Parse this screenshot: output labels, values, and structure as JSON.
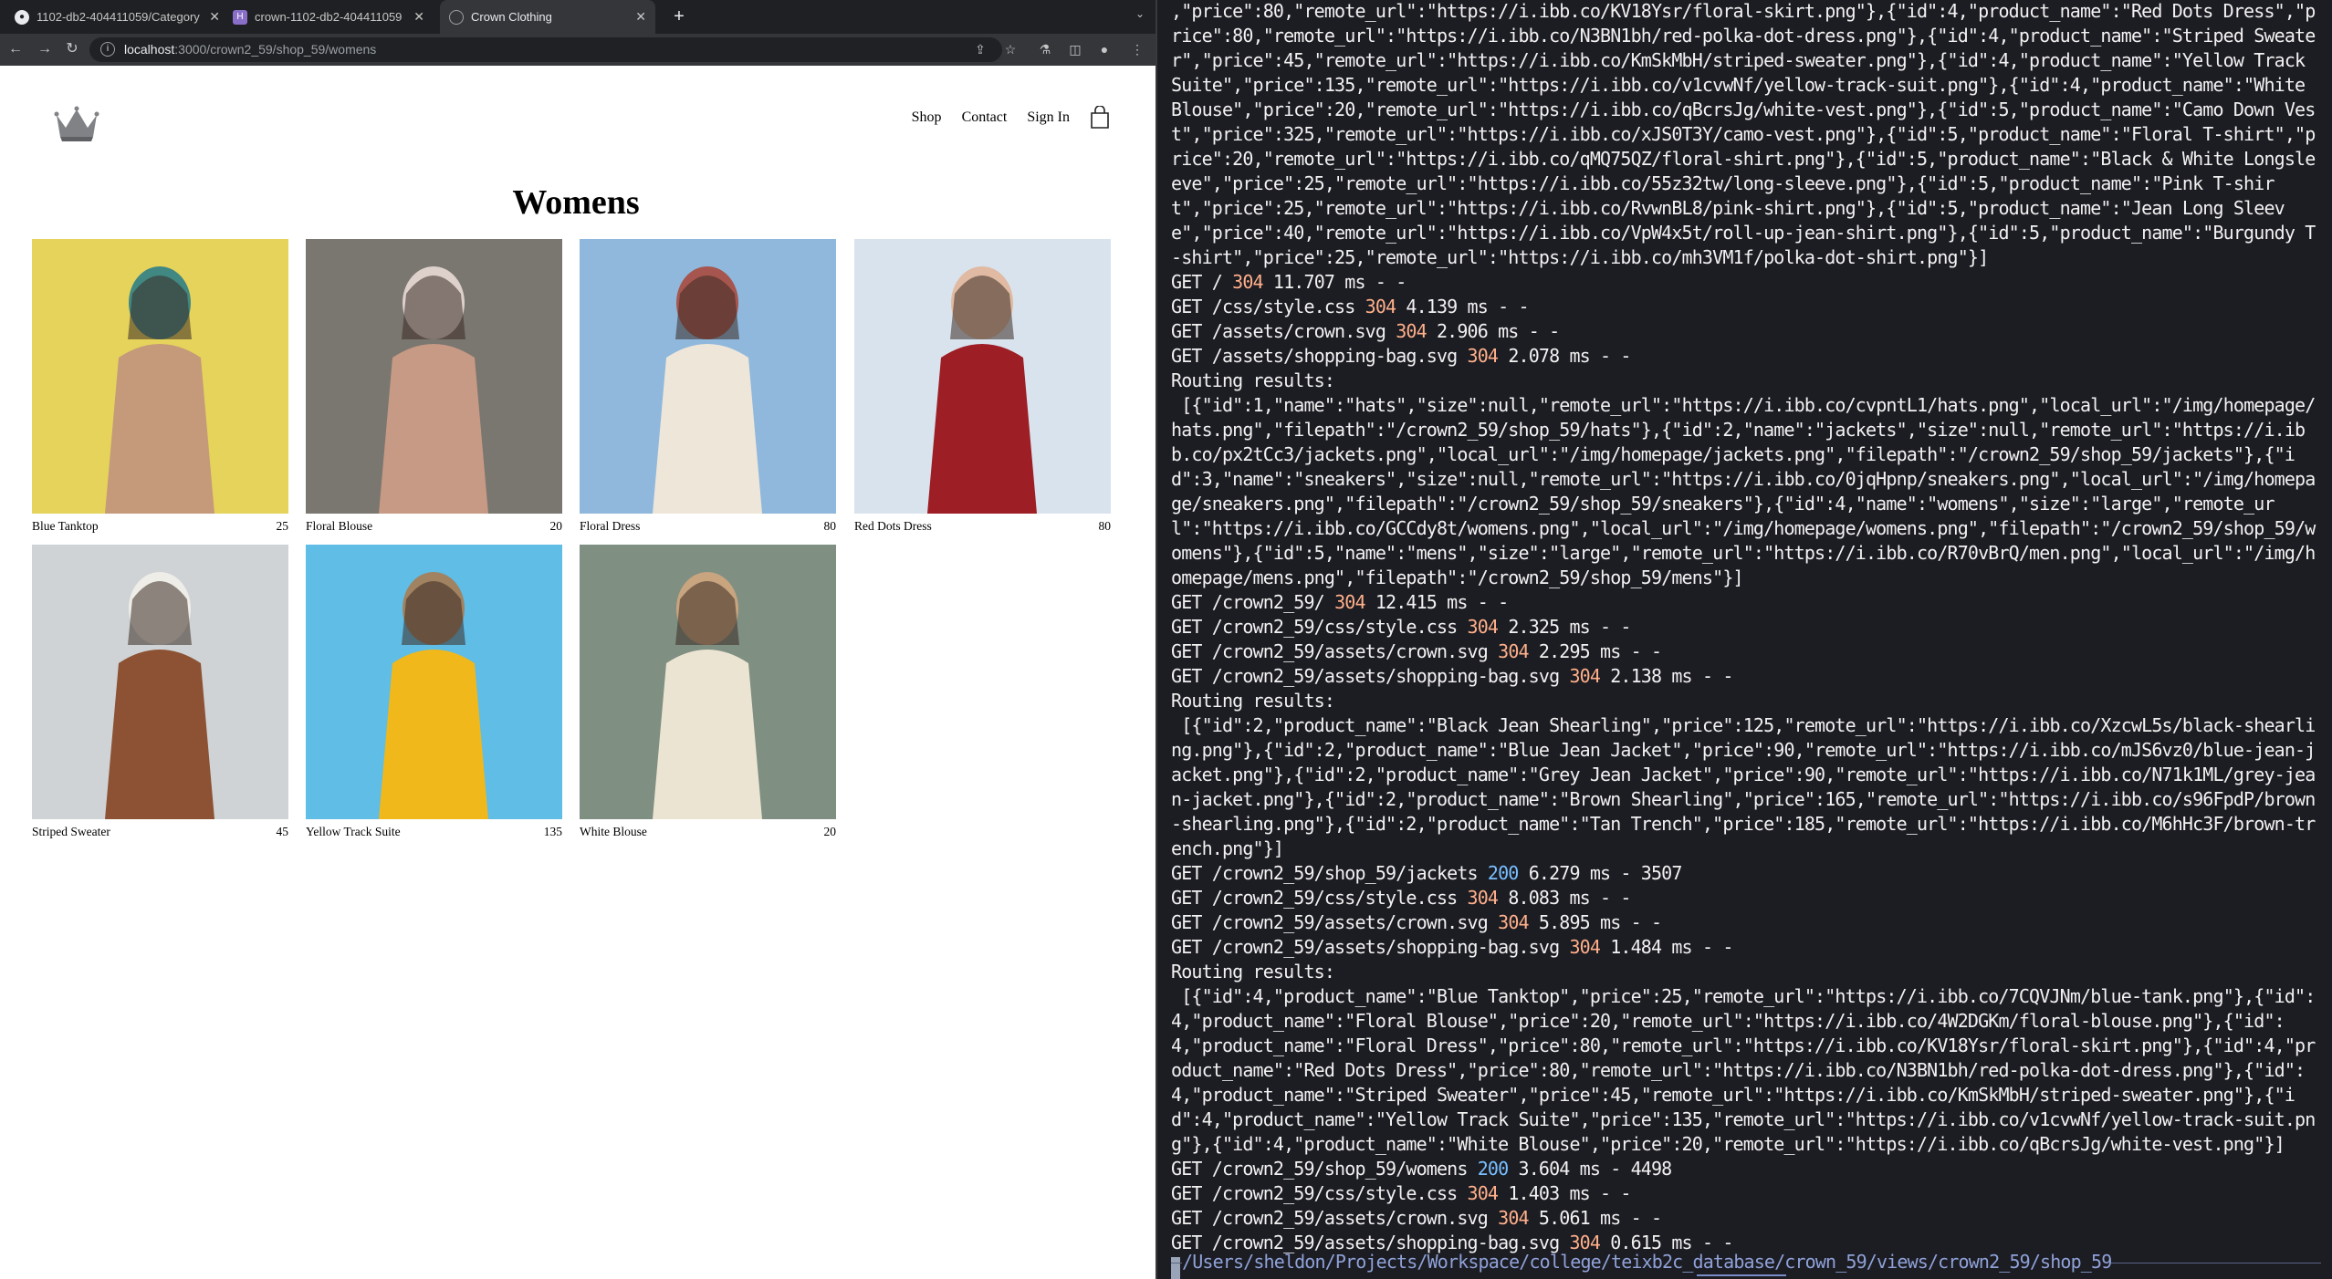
{
  "browser": {
    "tabs": [
      {
        "title": "1102-db2-404411059/Category",
        "favicon": "github-icon"
      },
      {
        "title": "crown-1102-db2-404411059",
        "favicon": "heroku-icon"
      },
      {
        "title": "Crown Clothing",
        "favicon": "globe-icon",
        "active": true
      }
    ],
    "url_host": "localhost",
    "url_path": ":3000/crown2_59/shop_59/womens"
  },
  "site": {
    "nav": {
      "shop": "Shop",
      "contact": "Contact",
      "sign_in": "Sign In"
    },
    "page_title": "Womens",
    "products": [
      {
        "name": "Blue Tanktop",
        "price": "25",
        "palette": [
          "#e6d35c",
          "#c49a7a",
          "#2f7f86"
        ]
      },
      {
        "name": "Floral Blouse",
        "price": "20",
        "palette": [
          "#7a7670",
          "#c69a84",
          "#e9dcd6"
        ]
      },
      {
        "name": "Floral Dress",
        "price": "80",
        "palette": [
          "#8fb8dc",
          "#efe6da",
          "#a94b3e"
        ]
      },
      {
        "name": "Red Dots Dress",
        "price": "80",
        "palette": [
          "#d9e3ee",
          "#9d1e24",
          "#e0b599"
        ]
      },
      {
        "name": "Striped Sweater",
        "price": "45",
        "palette": [
          "#cfd3d6",
          "#8c5233",
          "#f2efea"
        ]
      },
      {
        "name": "Yellow Track Suite",
        "price": "135",
        "palette": [
          "#5fbde6",
          "#f0b81a",
          "#a87b52"
        ]
      },
      {
        "name": "White Blouse",
        "price": "20",
        "palette": [
          "#7f8f82",
          "#ece4d2",
          "#d0a67e"
        ]
      }
    ]
  },
  "terminal": {
    "lines": [
      {
        "text": ",\"price\":80,\"remote_url\":\"https://i.ibb.co/KV18Ysr/floral-skirt.png\"},{\"id\":4,\"product_name\":\"Red Dots Dress\",\"price\":80,\"remote_url\":\"https://i.ibb.co/N3BN1bh/red-polka-dot-dress.png\"},{\"id\":4,\"product_name\":\"Striped Sweater\",\"price\":45,\"remote_url\":\"https://i.ibb.co/KmSkMbH/striped-sweater.png\"},{\"id\":4,\"product_name\":\"Yellow Track Suite\",\"price\":135,\"remote_url\":\"https://i.ibb.co/v1cvwNf/yellow-track-suit.png\"},{\"id\":4,\"product_name\":\"White Blouse\",\"price\":20,\"remote_url\":\"https://i.ibb.co/qBcrsJg/white-vest.png\"},{\"id\":5,\"product_name\":\"Camo Down Vest\",\"price\":325,\"remote_url\":\"https://i.ibb.co/xJS0T3Y/camo-vest.png\"},{\"id\":5,\"product_name\":\"Floral T-shirt\",\"price\":20,\"remote_url\":\"https://i.ibb.co/qMQ75QZ/floral-shirt.png\"},{\"id\":5,\"product_name\":\"Black & White Longsleeve\",\"price\":25,\"remote_url\":\"https://i.ibb.co/55z32tw/long-sleeve.png\"},{\"id\":5,\"product_name\":\"Pink T-shirt\",\"price\":25,\"remote_url\":\"https://i.ibb.co/RvwnBL8/pink-shirt.png\"},{\"id\":5,\"product_name\":\"Jean Long Sleeve\",\"price\":40,\"remote_url\":\"https://i.ibb.co/VpW4x5t/roll-up-jean-shirt.png\"},{\"id\":5,\"product_name\":\"Burgundy T-shirt\",\"price\":25,\"remote_url\":\"https://i.ibb.co/mh3VM1f/polka-dot-shirt.png\"}]"
      },
      {
        "pre": "GET / ",
        "code": "304",
        "post": " 11.707 ms - -"
      },
      {
        "pre": "GET /css/style.css ",
        "code": "304",
        "post": " 4.139 ms - -"
      },
      {
        "pre": "GET /assets/crown.svg ",
        "code": "304",
        "post": " 2.906 ms - -"
      },
      {
        "pre": "GET /assets/shopping-bag.svg ",
        "code": "304",
        "post": " 2.078 ms - -"
      },
      {
        "text": "Routing results:"
      },
      {
        "text": " [{\"id\":1,\"name\":\"hats\",\"size\":null,\"remote_url\":\"https://i.ibb.co/cvpntL1/hats.png\",\"local_url\":\"/img/homepage/hats.png\",\"filepath\":\"/crown2_59/shop_59/hats\"},{\"id\":2,\"name\":\"jackets\",\"size\":null,\"remote_url\":\"https://i.ibb.co/px2tCc3/jackets.png\",\"local_url\":\"/img/homepage/jackets.png\",\"filepath\":\"/crown2_59/shop_59/jackets\"},{\"id\":3,\"name\":\"sneakers\",\"size\":null,\"remote_url\":\"https://i.ibb.co/0jqHpnp/sneakers.png\",\"local_url\":\"/img/homepage/sneakers.png\",\"filepath\":\"/crown2_59/shop_59/sneakers\"},{\"id\":4,\"name\":\"womens\",\"size\":\"large\",\"remote_url\":\"https://i.ibb.co/GCCdy8t/womens.png\",\"local_url\":\"/img/homepage/womens.png\",\"filepath\":\"/crown2_59/shop_59/womens\"},{\"id\":5,\"name\":\"mens\",\"size\":\"large\",\"remote_url\":\"https://i.ibb.co/R70vBrQ/men.png\",\"local_url\":\"/img/homepage/mens.png\",\"filepath\":\"/crown2_59/shop_59/mens\"}]"
      },
      {
        "pre": "GET /crown2_59/ ",
        "code": "304",
        "post": " 12.415 ms - -"
      },
      {
        "pre": "GET /crown2_59/css/style.css ",
        "code": "304",
        "post": " 2.325 ms - -"
      },
      {
        "pre": "GET /crown2_59/assets/crown.svg ",
        "code": "304",
        "post": " 2.295 ms - -"
      },
      {
        "pre": "GET /crown2_59/assets/shopping-bag.svg ",
        "code": "304",
        "post": " 2.138 ms - -"
      },
      {
        "text": "Routing results:"
      },
      {
        "text": " [{\"id\":2,\"product_name\":\"Black Jean Shearling\",\"price\":125,\"remote_url\":\"https://i.ibb.co/XzcwL5s/black-shearling.png\"},{\"id\":2,\"product_name\":\"Blue Jean Jacket\",\"price\":90,\"remote_url\":\"https://i.ibb.co/mJS6vz0/blue-jean-jacket.png\"},{\"id\":2,\"product_name\":\"Grey Jean Jacket\",\"price\":90,\"remote_url\":\"https://i.ibb.co/N71k1ML/grey-jean-jacket.png\"},{\"id\":2,\"product_name\":\"Brown Shearling\",\"price\":165,\"remote_url\":\"https://i.ibb.co/s96FpdP/brown-shearling.png\"},{\"id\":2,\"product_name\":\"Tan Trench\",\"price\":185,\"remote_url\":\"https://i.ibb.co/M6hHc3F/brown-trench.png\"}]"
      },
      {
        "pre": "GET /crown2_59/shop_59/jackets ",
        "code": "200",
        "post": " 6.279 ms - 3507"
      },
      {
        "pre": "GET /crown2_59/css/style.css ",
        "code": "304",
        "post": " 8.083 ms - -"
      },
      {
        "pre": "GET /crown2_59/assets/crown.svg ",
        "code": "304",
        "post": " 5.895 ms - -"
      },
      {
        "pre": "GET /crown2_59/assets/shopping-bag.svg ",
        "code": "304",
        "post": " 1.484 ms - -"
      },
      {
        "text": "Routing results:"
      },
      {
        "text": " [{\"id\":4,\"product_name\":\"Blue Tanktop\",\"price\":25,\"remote_url\":\"https://i.ibb.co/7CQVJNm/blue-tank.png\"},{\"id\":4,\"product_name\":\"Floral Blouse\",\"price\":20,\"remote_url\":\"https://i.ibb.co/4W2DGKm/floral-blouse.png\"},{\"id\":4,\"product_name\":\"Floral Dress\",\"price\":80,\"remote_url\":\"https://i.ibb.co/KV18Ysr/floral-skirt.png\"},{\"id\":4,\"product_name\":\"Red Dots Dress\",\"price\":80,\"remote_url\":\"https://i.ibb.co/N3BN1bh/red-polka-dot-dress.png\"},{\"id\":4,\"product_name\":\"Striped Sweater\",\"price\":45,\"remote_url\":\"https://i.ibb.co/KmSkMbH/striped-sweater.png\"},{\"id\":4,\"product_name\":\"Yellow Track Suite\",\"price\":135,\"remote_url\":\"https://i.ibb.co/v1cvwNf/yellow-track-suit.png\"},{\"id\":4,\"product_name\":\"White Blouse\",\"price\":20,\"remote_url\":\"https://i.ibb.co/qBcrsJg/white-vest.png\"}]"
      },
      {
        "pre": "GET /crown2_59/shop_59/womens ",
        "code": "200",
        "post": " 3.604 ms - 4498"
      },
      {
        "pre": "GET /crown2_59/css/style.css ",
        "code": "304",
        "post": " 1.403 ms - -"
      },
      {
        "pre": "GET /crown2_59/assets/crown.svg ",
        "code": "304",
        "post": " 5.061 ms - -"
      },
      {
        "pre": "GET /crown2_59/assets/shopping-bag.svg ",
        "code": "304",
        "post": " 0.615 ms - -"
      }
    ],
    "prompt_path": "/Users/sheldon/Projects/Workspace/college/teixb2c_database/crown_59/views/crown2_59/shop_59",
    "colors": {
      "background": "#1c1c23",
      "status_304": "#ffb08a",
      "status_200": "#79c0ff",
      "prompt": "#8fa2d8"
    }
  }
}
